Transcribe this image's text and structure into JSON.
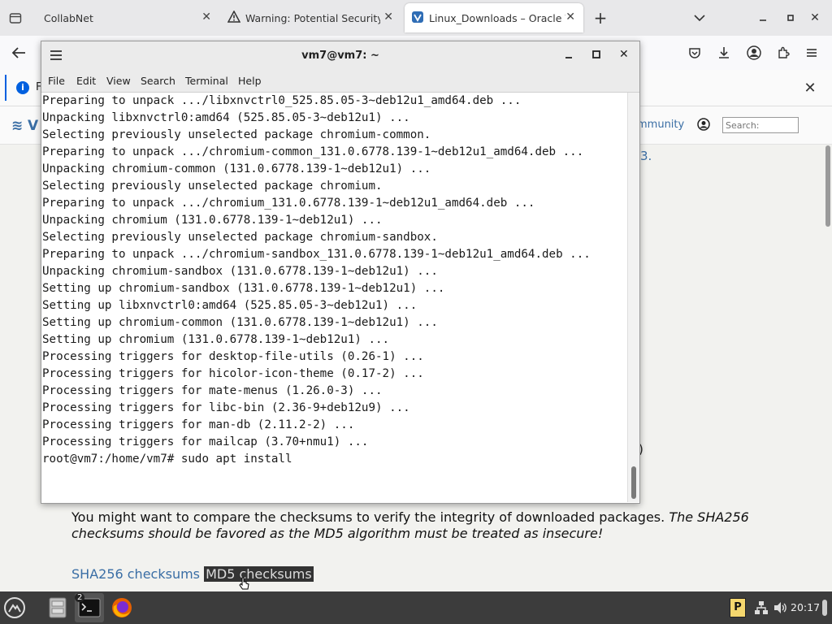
{
  "browser": {
    "tabs": [
      {
        "title": "CollabNet"
      },
      {
        "title": "Warning: Potential Security R"
      },
      {
        "title": "Linux_Downloads – Oracle V"
      }
    ],
    "new_tab_label": "+"
  },
  "notification": {
    "text": "F"
  },
  "page": {
    "subnav_logo": "V",
    "subnav_community": "mmunity",
    "search_placeholder": "Search:",
    "right_fragment": "3.",
    "paren_fragment": ")",
    "checksum_text": "You might want to compare the checksums to verify the integrity of downloaded packages. ",
    "checksum_text_italic": "The SHA256 checksums should be favored as the MD5 algorithm must be treated as insecure!",
    "sha256_link": "SHA256 checksums",
    "md5_link": "MD5 checksums"
  },
  "terminal": {
    "title": "vm7@vm7: ~",
    "menu": [
      "File",
      "Edit",
      "View",
      "Search",
      "Terminal",
      "Help"
    ],
    "lines": [
      "Preparing to unpack .../libxnvctrl0_525.85.05-3~deb12u1_amd64.deb ...",
      "Unpacking libxnvctrl0:amd64 (525.85.05-3~deb12u1) ...",
      "Selecting previously unselected package chromium-common.",
      "Preparing to unpack .../chromium-common_131.0.6778.139-1~deb12u1_amd64.deb ...",
      "Unpacking chromium-common (131.0.6778.139-1~deb12u1) ...",
      "Selecting previously unselected package chromium.",
      "Preparing to unpack .../chromium_131.0.6778.139-1~deb12u1_amd64.deb ...",
      "Unpacking chromium (131.0.6778.139-1~deb12u1) ...",
      "Selecting previously unselected package chromium-sandbox.",
      "Preparing to unpack .../chromium-sandbox_131.0.6778.139-1~deb12u1_amd64.deb ...",
      "Unpacking chromium-sandbox (131.0.6778.139-1~deb12u1) ...",
      "Setting up chromium-sandbox (131.0.6778.139-1~deb12u1) ...",
      "Setting up libxnvctrl0:amd64 (525.85.05-3~deb12u1) ...",
      "Setting up chromium-common (131.0.6778.139-1~deb12u1) ...",
      "Setting up chromium (131.0.6778.139-1~deb12u1) ...",
      "Processing triggers for desktop-file-utils (0.26-1) ...",
      "Processing triggers for hicolor-icon-theme (0.17-2) ...",
      "Processing triggers for mate-menus (1.26.0-3) ...",
      "Processing triggers for libc-bin (2.36-9+deb12u9) ...",
      "Processing triggers for man-db (2.11.2-2) ...",
      "Processing triggers for mailcap (3.70+nmu1) ...",
      "root@vm7:/home/vm7# sudo apt install"
    ]
  },
  "taskbar": {
    "terminal_badge": "2",
    "clock": "20:17",
    "tray_p": "P"
  },
  "colors": {
    "link": "#3a6ea5",
    "taskbar": "#3c3c3c",
    "firefox": "#e66000"
  }
}
